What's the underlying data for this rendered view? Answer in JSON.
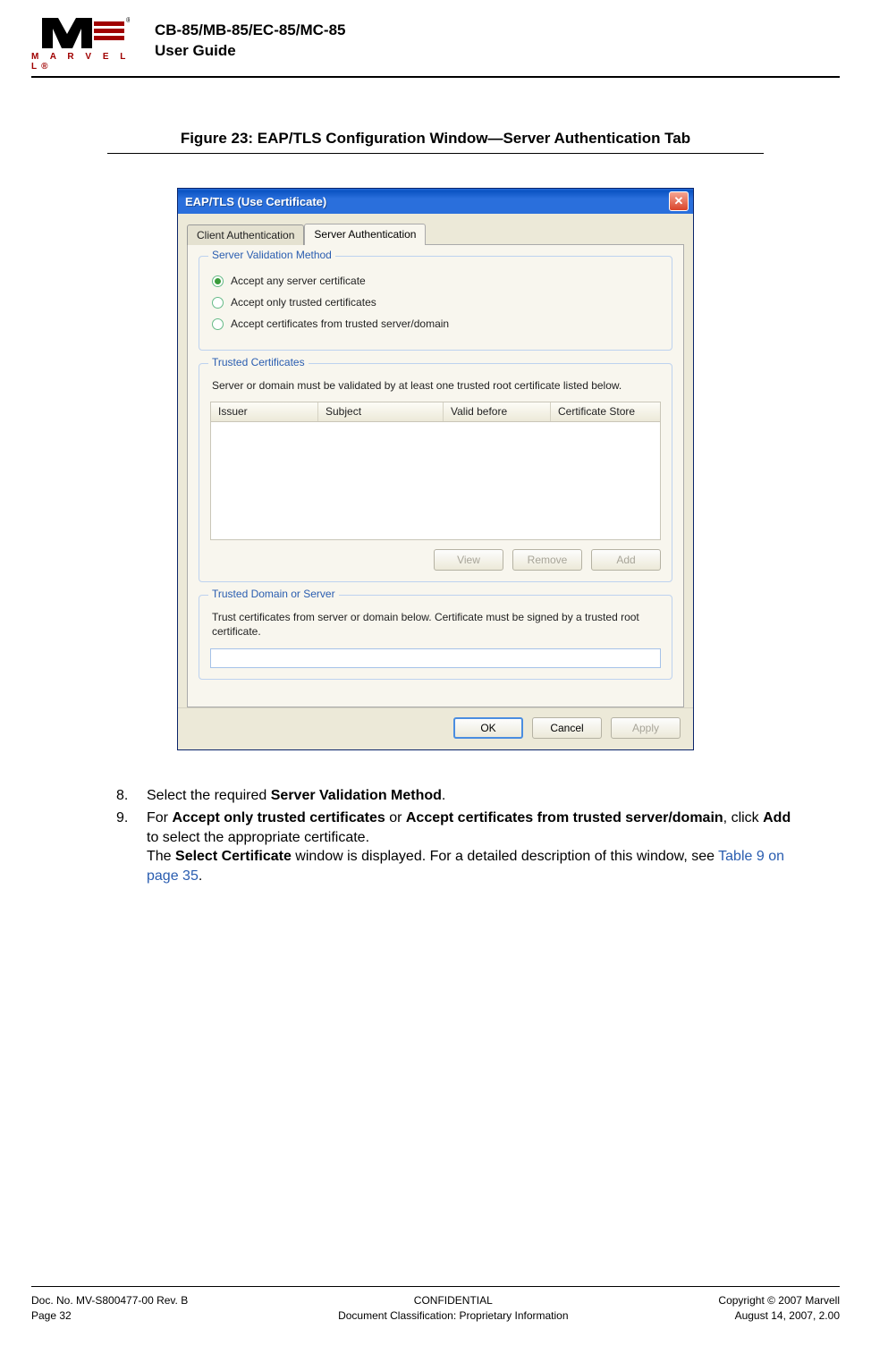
{
  "header": {
    "logo_text": "M A R V E L L®",
    "title_line1": "CB-85/MB-85/EC-85/MC-85",
    "title_line2": "User Guide"
  },
  "figure_caption": "Figure 23: EAP/TLS Configuration Window—Server Authentication Tab",
  "window": {
    "title": "EAP/TLS (Use Certificate)",
    "tabs": {
      "client": "Client Authentication",
      "server": "Server Authentication"
    },
    "group_validation": {
      "legend": "Server Validation Method",
      "opt1": "Accept any server certificate",
      "opt2": "Accept only trusted certificates",
      "opt3": "Accept certificates from trusted server/domain"
    },
    "group_trusted_certs": {
      "legend": "Trusted Certificates",
      "note": "Server or domain must be validated by at least one trusted root certificate listed below.",
      "cols": {
        "issuer": "Issuer",
        "subject": "Subject",
        "valid": "Valid before",
        "store": "Certificate Store"
      },
      "buttons": {
        "view": "View",
        "remove": "Remove",
        "add": "Add"
      }
    },
    "group_trusted_domain": {
      "legend": "Trusted Domain or Server",
      "note": "Trust certificates from server or domain below. Certificate must be signed by a trusted root certificate.",
      "value": ""
    },
    "dialog_buttons": {
      "ok": "OK",
      "cancel": "Cancel",
      "apply": "Apply"
    }
  },
  "steps": {
    "s8_num": "8.",
    "s8_a": "Select the required ",
    "s8_b": "Server Validation Method",
    "s8_c": ".",
    "s9_num": "9.",
    "s9_a": "For ",
    "s9_b": "Accept only trusted certificates",
    "s9_c": " or ",
    "s9_d": "Accept certificates from trusted server/domain",
    "s9_e": ", click ",
    "s9_f": "Add",
    "s9_g": " to select the appropriate certificate.",
    "s9_h": "The ",
    "s9_i": "Select Certificate",
    "s9_j": " window is displayed. For a detailed description of this window, see ",
    "s9_link": "Table 9 on page 35",
    "s9_k": "."
  },
  "footer": {
    "left1": "Doc. No. MV-S800477-00 Rev. B",
    "left2": "Page 32",
    "center1": "CONFIDENTIAL",
    "center2": "Document Classification: Proprietary Information",
    "right1": "Copyright © 2007 Marvell",
    "right2": "August 14, 2007, 2.00"
  }
}
